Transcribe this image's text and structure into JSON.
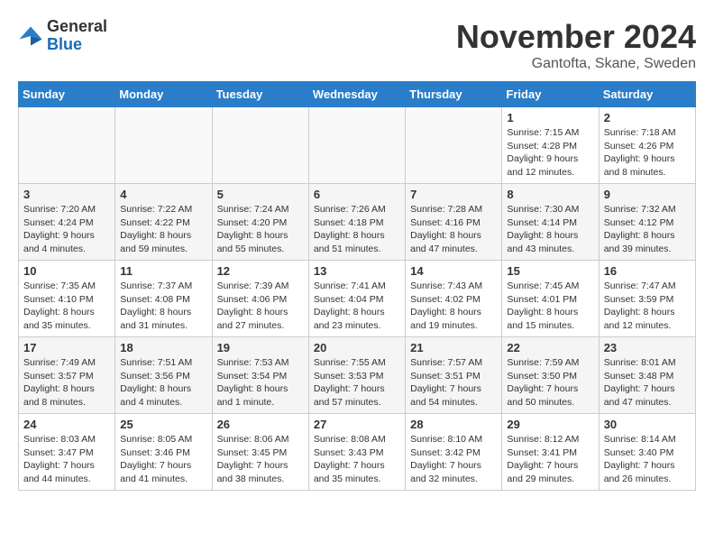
{
  "header": {
    "logo_general": "General",
    "logo_blue": "Blue",
    "month_title": "November 2024",
    "location": "Gantofta, Skane, Sweden"
  },
  "weekdays": [
    "Sunday",
    "Monday",
    "Tuesday",
    "Wednesday",
    "Thursday",
    "Friday",
    "Saturday"
  ],
  "weeks": [
    [
      {
        "day": "",
        "info": ""
      },
      {
        "day": "",
        "info": ""
      },
      {
        "day": "",
        "info": ""
      },
      {
        "day": "",
        "info": ""
      },
      {
        "day": "",
        "info": ""
      },
      {
        "day": "1",
        "info": "Sunrise: 7:15 AM\nSunset: 4:28 PM\nDaylight: 9 hours and 12 minutes."
      },
      {
        "day": "2",
        "info": "Sunrise: 7:18 AM\nSunset: 4:26 PM\nDaylight: 9 hours and 8 minutes."
      }
    ],
    [
      {
        "day": "3",
        "info": "Sunrise: 7:20 AM\nSunset: 4:24 PM\nDaylight: 9 hours and 4 minutes."
      },
      {
        "day": "4",
        "info": "Sunrise: 7:22 AM\nSunset: 4:22 PM\nDaylight: 8 hours and 59 minutes."
      },
      {
        "day": "5",
        "info": "Sunrise: 7:24 AM\nSunset: 4:20 PM\nDaylight: 8 hours and 55 minutes."
      },
      {
        "day": "6",
        "info": "Sunrise: 7:26 AM\nSunset: 4:18 PM\nDaylight: 8 hours and 51 minutes."
      },
      {
        "day": "7",
        "info": "Sunrise: 7:28 AM\nSunset: 4:16 PM\nDaylight: 8 hours and 47 minutes."
      },
      {
        "day": "8",
        "info": "Sunrise: 7:30 AM\nSunset: 4:14 PM\nDaylight: 8 hours and 43 minutes."
      },
      {
        "day": "9",
        "info": "Sunrise: 7:32 AM\nSunset: 4:12 PM\nDaylight: 8 hours and 39 minutes."
      }
    ],
    [
      {
        "day": "10",
        "info": "Sunrise: 7:35 AM\nSunset: 4:10 PM\nDaylight: 8 hours and 35 minutes."
      },
      {
        "day": "11",
        "info": "Sunrise: 7:37 AM\nSunset: 4:08 PM\nDaylight: 8 hours and 31 minutes."
      },
      {
        "day": "12",
        "info": "Sunrise: 7:39 AM\nSunset: 4:06 PM\nDaylight: 8 hours and 27 minutes."
      },
      {
        "day": "13",
        "info": "Sunrise: 7:41 AM\nSunset: 4:04 PM\nDaylight: 8 hours and 23 minutes."
      },
      {
        "day": "14",
        "info": "Sunrise: 7:43 AM\nSunset: 4:02 PM\nDaylight: 8 hours and 19 minutes."
      },
      {
        "day": "15",
        "info": "Sunrise: 7:45 AM\nSunset: 4:01 PM\nDaylight: 8 hours and 15 minutes."
      },
      {
        "day": "16",
        "info": "Sunrise: 7:47 AM\nSunset: 3:59 PM\nDaylight: 8 hours and 12 minutes."
      }
    ],
    [
      {
        "day": "17",
        "info": "Sunrise: 7:49 AM\nSunset: 3:57 PM\nDaylight: 8 hours and 8 minutes."
      },
      {
        "day": "18",
        "info": "Sunrise: 7:51 AM\nSunset: 3:56 PM\nDaylight: 8 hours and 4 minutes."
      },
      {
        "day": "19",
        "info": "Sunrise: 7:53 AM\nSunset: 3:54 PM\nDaylight: 8 hours and 1 minute."
      },
      {
        "day": "20",
        "info": "Sunrise: 7:55 AM\nSunset: 3:53 PM\nDaylight: 7 hours and 57 minutes."
      },
      {
        "day": "21",
        "info": "Sunrise: 7:57 AM\nSunset: 3:51 PM\nDaylight: 7 hours and 54 minutes."
      },
      {
        "day": "22",
        "info": "Sunrise: 7:59 AM\nSunset: 3:50 PM\nDaylight: 7 hours and 50 minutes."
      },
      {
        "day": "23",
        "info": "Sunrise: 8:01 AM\nSunset: 3:48 PM\nDaylight: 7 hours and 47 minutes."
      }
    ],
    [
      {
        "day": "24",
        "info": "Sunrise: 8:03 AM\nSunset: 3:47 PM\nDaylight: 7 hours and 44 minutes."
      },
      {
        "day": "25",
        "info": "Sunrise: 8:05 AM\nSunset: 3:46 PM\nDaylight: 7 hours and 41 minutes."
      },
      {
        "day": "26",
        "info": "Sunrise: 8:06 AM\nSunset: 3:45 PM\nDaylight: 7 hours and 38 minutes."
      },
      {
        "day": "27",
        "info": "Sunrise: 8:08 AM\nSunset: 3:43 PM\nDaylight: 7 hours and 35 minutes."
      },
      {
        "day": "28",
        "info": "Sunrise: 8:10 AM\nSunset: 3:42 PM\nDaylight: 7 hours and 32 minutes."
      },
      {
        "day": "29",
        "info": "Sunrise: 8:12 AM\nSunset: 3:41 PM\nDaylight: 7 hours and 29 minutes."
      },
      {
        "day": "30",
        "info": "Sunrise: 8:14 AM\nSunset: 3:40 PM\nDaylight: 7 hours and 26 minutes."
      }
    ]
  ]
}
